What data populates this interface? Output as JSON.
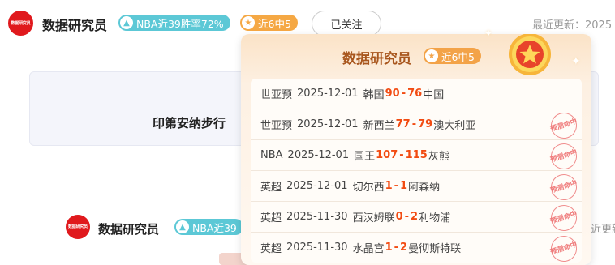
{
  "header": {
    "avatar_text": "数据研究员",
    "name": "数据研究员",
    "nba_badge": "NBA近39胜率72%",
    "streak_badge": "近6中5",
    "follow_label": "已关注",
    "updated_label": "最近更新：2025"
  },
  "card": {
    "text": "印第安纳步行"
  },
  "second": {
    "name": "数据研究员",
    "nba_badge": "NBA近39",
    "updated_label": "近更新"
  },
  "popover": {
    "title": "数据研究员",
    "streak": "近6中5",
    "stamp_text": "预测命中",
    "matches": [
      {
        "league": "世亚预",
        "date": "2025-12-01",
        "home": "韩国",
        "home_score": "90",
        "sep": " - ",
        "away_score": "76",
        "away": "中国",
        "hit": false
      },
      {
        "league": "世亚预",
        "date": "2025-12-01",
        "home": "新西兰",
        "home_score": "77",
        "sep": " - ",
        "away_score": "79",
        "away": "澳大利亚",
        "hit": true
      },
      {
        "league": "NBA",
        "date": "2025-12-01",
        "home": "国王",
        "home_score": "107",
        "sep": " - ",
        "away_score": "115",
        "away": "灰熊",
        "hit": true
      },
      {
        "league": "英超",
        "date": "2025-12-01",
        "home": "切尔西",
        "home_score": "1",
        "sep": " - ",
        "away_score": "1",
        "away": "阿森纳",
        "hit": true
      },
      {
        "league": "英超",
        "date": "2025-11-30",
        "home": "西汉姆联",
        "home_score": "0",
        "sep": " - ",
        "away_score": "2",
        "away": "利物浦",
        "hit": true
      },
      {
        "league": "英超",
        "date": "2025-11-30",
        "home": "水晶宫",
        "home_score": "1",
        "sep": " - ",
        "away_score": "2",
        "away": "曼彻斯特联",
        "hit": true
      }
    ]
  },
  "colors": {
    "brand_red": "#e0191d",
    "nba_badge": "#5cc8d6",
    "streak_badge": "#f5a844",
    "score": "#f24b12",
    "stamp": "#ef7b7b"
  },
  "icons": {
    "nba_badge_icon": "arrow-up-icon",
    "streak_icon": "star-icon",
    "medal_icon": "medal-star-icon"
  }
}
